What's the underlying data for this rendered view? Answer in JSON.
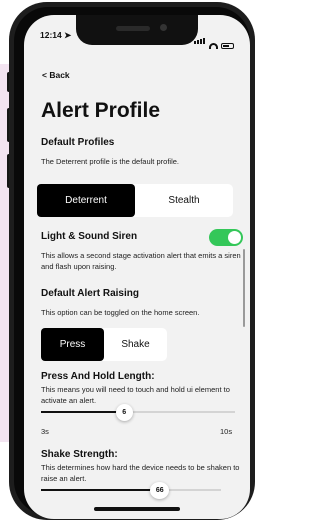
{
  "status_bar": {
    "time": "12:14",
    "icons": [
      "location-arrow-icon",
      "signal-icon",
      "wifi-icon",
      "battery-icon"
    ]
  },
  "nav": {
    "back_label": "Back"
  },
  "page": {
    "title": "Alert Profile"
  },
  "default_profiles": {
    "heading": "Default Profiles",
    "description": "The Deterrent profile is the default profile.",
    "options": [
      "Deterrent",
      "Stealth"
    ],
    "selected": "Deterrent"
  },
  "siren": {
    "heading": "Light & Sound Siren",
    "enabled": true,
    "description": "This allows a second stage activation alert that emits a siren and flash upon raising."
  },
  "alert_raising": {
    "heading": "Default Alert Raising",
    "description": "This option can be toggled on the home screen.",
    "options": [
      "Press",
      "Shake"
    ],
    "selected": "Press"
  },
  "press_hold": {
    "heading": "Press And Hold Length:",
    "description": "This means you will need to touch and hold ui element to activate an alert.",
    "value": 6,
    "min_label": "3s",
    "max_label": "10s",
    "min": 3,
    "max": 10
  },
  "shake": {
    "heading": "Shake Strength:",
    "description": "This determines how hard the device needs to be shaken to raise an alert.",
    "value": 66,
    "min": 0,
    "max": 100
  },
  "colors": {
    "toggle_on": "#34c759",
    "accent": "#000000",
    "background": "#f2f2f2",
    "side_tint": "#f3e4f1"
  }
}
